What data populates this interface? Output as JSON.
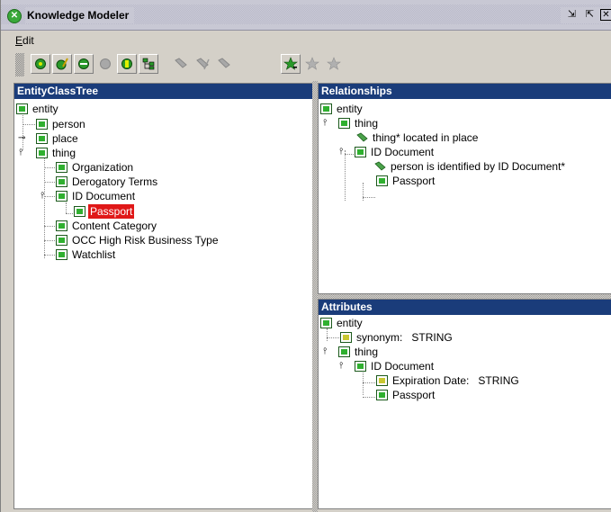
{
  "window": {
    "title": "Knowledge Modeler"
  },
  "menu": {
    "edit_mnemonic": "E",
    "edit_rest": "dit"
  },
  "colors": {
    "panel_header": "#1a3c7a",
    "selection": "#e01818",
    "node_green": "#2fb02f"
  },
  "toolbar": {
    "buttons": [
      {
        "icon": "add-class-icon",
        "enabled": true
      },
      {
        "icon": "edit-class-icon",
        "enabled": true
      },
      {
        "icon": "class-icon",
        "enabled": true
      },
      {
        "icon": "class-disabled-icon",
        "enabled": false
      },
      {
        "icon": "instance-icon",
        "enabled": true
      },
      {
        "icon": "hierarchy-icon",
        "enabled": true
      },
      {
        "icon": "relation-add-icon",
        "enabled": false
      },
      {
        "icon": "relation-edit-icon",
        "enabled": false
      },
      {
        "icon": "relation-delete-icon",
        "enabled": false
      },
      {
        "icon": "star-add-icon",
        "enabled": true
      },
      {
        "icon": "star-edit-icon",
        "enabled": false
      },
      {
        "icon": "star-icon",
        "enabled": false
      }
    ]
  },
  "entity_tree": {
    "header": "EntityClassTree",
    "nodes": {
      "entity": "entity",
      "person": "person",
      "place": "place",
      "thing": "thing",
      "organization": "Organization",
      "derogatory": "Derogatory Terms",
      "id_document": "ID Document",
      "passport": "Passport",
      "content_category": "Content Category",
      "occ": "OCC High Risk Business Type",
      "watchlist": "Watchlist"
    }
  },
  "relationships": {
    "header": "Relationships",
    "nodes": {
      "entity": "entity",
      "thing": "thing",
      "located": "thing* located in place",
      "id_document": "ID Document",
      "identified": "person is identified by ID Document*",
      "passport": "Passport"
    }
  },
  "attributes": {
    "header": "Attributes",
    "nodes": {
      "entity": "entity",
      "synonym": "synonym:   STRING",
      "thing": "thing",
      "id_document": "ID Document",
      "expiration": "Expiration Date:   STRING",
      "passport": "Passport"
    }
  }
}
